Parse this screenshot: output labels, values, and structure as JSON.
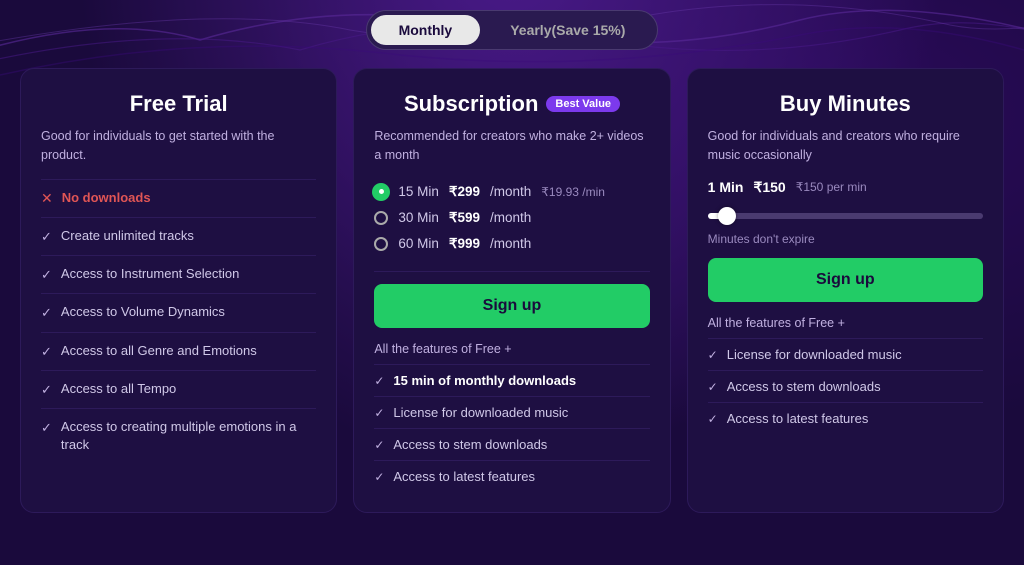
{
  "toggle": {
    "monthly_label": "Monthly",
    "yearly_label": "Yearly(Save 15%)"
  },
  "cards": {
    "free_trial": {
      "title": "Free Trial",
      "subtitle": "Good for individuals to get started with the product.",
      "features": [
        {
          "type": "x",
          "text": "No downloads"
        },
        {
          "type": "check",
          "text": "Create unlimited tracks"
        },
        {
          "type": "check",
          "text": "Access to Instrument Selection"
        },
        {
          "type": "check",
          "text": "Access to Volume Dynamics"
        },
        {
          "type": "check",
          "text": "Access to all Genre and Emotions"
        },
        {
          "type": "check",
          "text": "Access to all Tempo"
        },
        {
          "type": "check",
          "text": "Access to creating multiple emotions in a track"
        }
      ]
    },
    "subscription": {
      "title": "Subscription",
      "badge": "Best Value",
      "subtitle": "Recommended for creators who make 2+ videos a month",
      "options": [
        {
          "mins": "15 Min",
          "price": "₹299",
          "period": "/month",
          "per_min": "₹19.93 /min",
          "selected": true
        },
        {
          "mins": "30 Min",
          "price": "₹599",
          "period": "/month",
          "per_min": "",
          "selected": false
        },
        {
          "mins": "60 Min",
          "price": "₹999",
          "period": "/month",
          "per_min": "",
          "selected": false
        }
      ],
      "signup_label": "Sign up",
      "sub_features_title": "All the features of Free +",
      "sub_features": [
        {
          "text": "15 min of monthly downloads",
          "bold": true
        },
        {
          "text": "License for downloaded music",
          "bold": false
        },
        {
          "text": "Access to stem downloads",
          "bold": false
        },
        {
          "text": "Access to latest features",
          "bold": false
        }
      ]
    },
    "buy_minutes": {
      "title": "Buy Minutes",
      "subtitle": "Good for individuals and creators who require music occasionally",
      "min_label": "1 Min",
      "price": "₹150",
      "per_min": "₹150 per min",
      "slider_value": 5,
      "expire_note": "Minutes don't expire",
      "signup_label": "Sign up",
      "sub_features_title": "All the features of Free +",
      "sub_features": [
        {
          "text": "License for downloaded music",
          "bold": false
        },
        {
          "text": "Access to stem downloads",
          "bold": false
        },
        {
          "text": "Access to latest features",
          "bold": false
        }
      ]
    }
  }
}
